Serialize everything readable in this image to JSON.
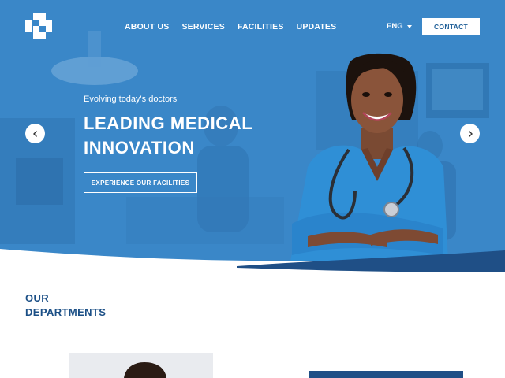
{
  "nav": {
    "items": [
      "ABOUT US",
      "SERVICES",
      "FACILITIES",
      "UPDATES"
    ],
    "language": "ENG",
    "contact_label": "CONTACT"
  },
  "hero": {
    "tagline": "Evolving today's doctors",
    "headline_line1": "LEADING MEDICAL",
    "headline_line2": "INNOVATION",
    "cta_label": "EXPERIENCE OUR FACILITIES"
  },
  "departments": {
    "title_line1": "OUR",
    "title_line2": "DEPARTMENTS"
  },
  "icons": {
    "logo": "medical-cross-logo-icon",
    "prev": "chevron-left-icon",
    "next": "chevron-right-icon",
    "language_caret": "caret-down-icon"
  },
  "colors": {
    "hero_blue": "#3a87c8",
    "dark_blue": "#1b4f86",
    "scrub_blue": "#2f8fd6",
    "white": "#ffffff"
  }
}
